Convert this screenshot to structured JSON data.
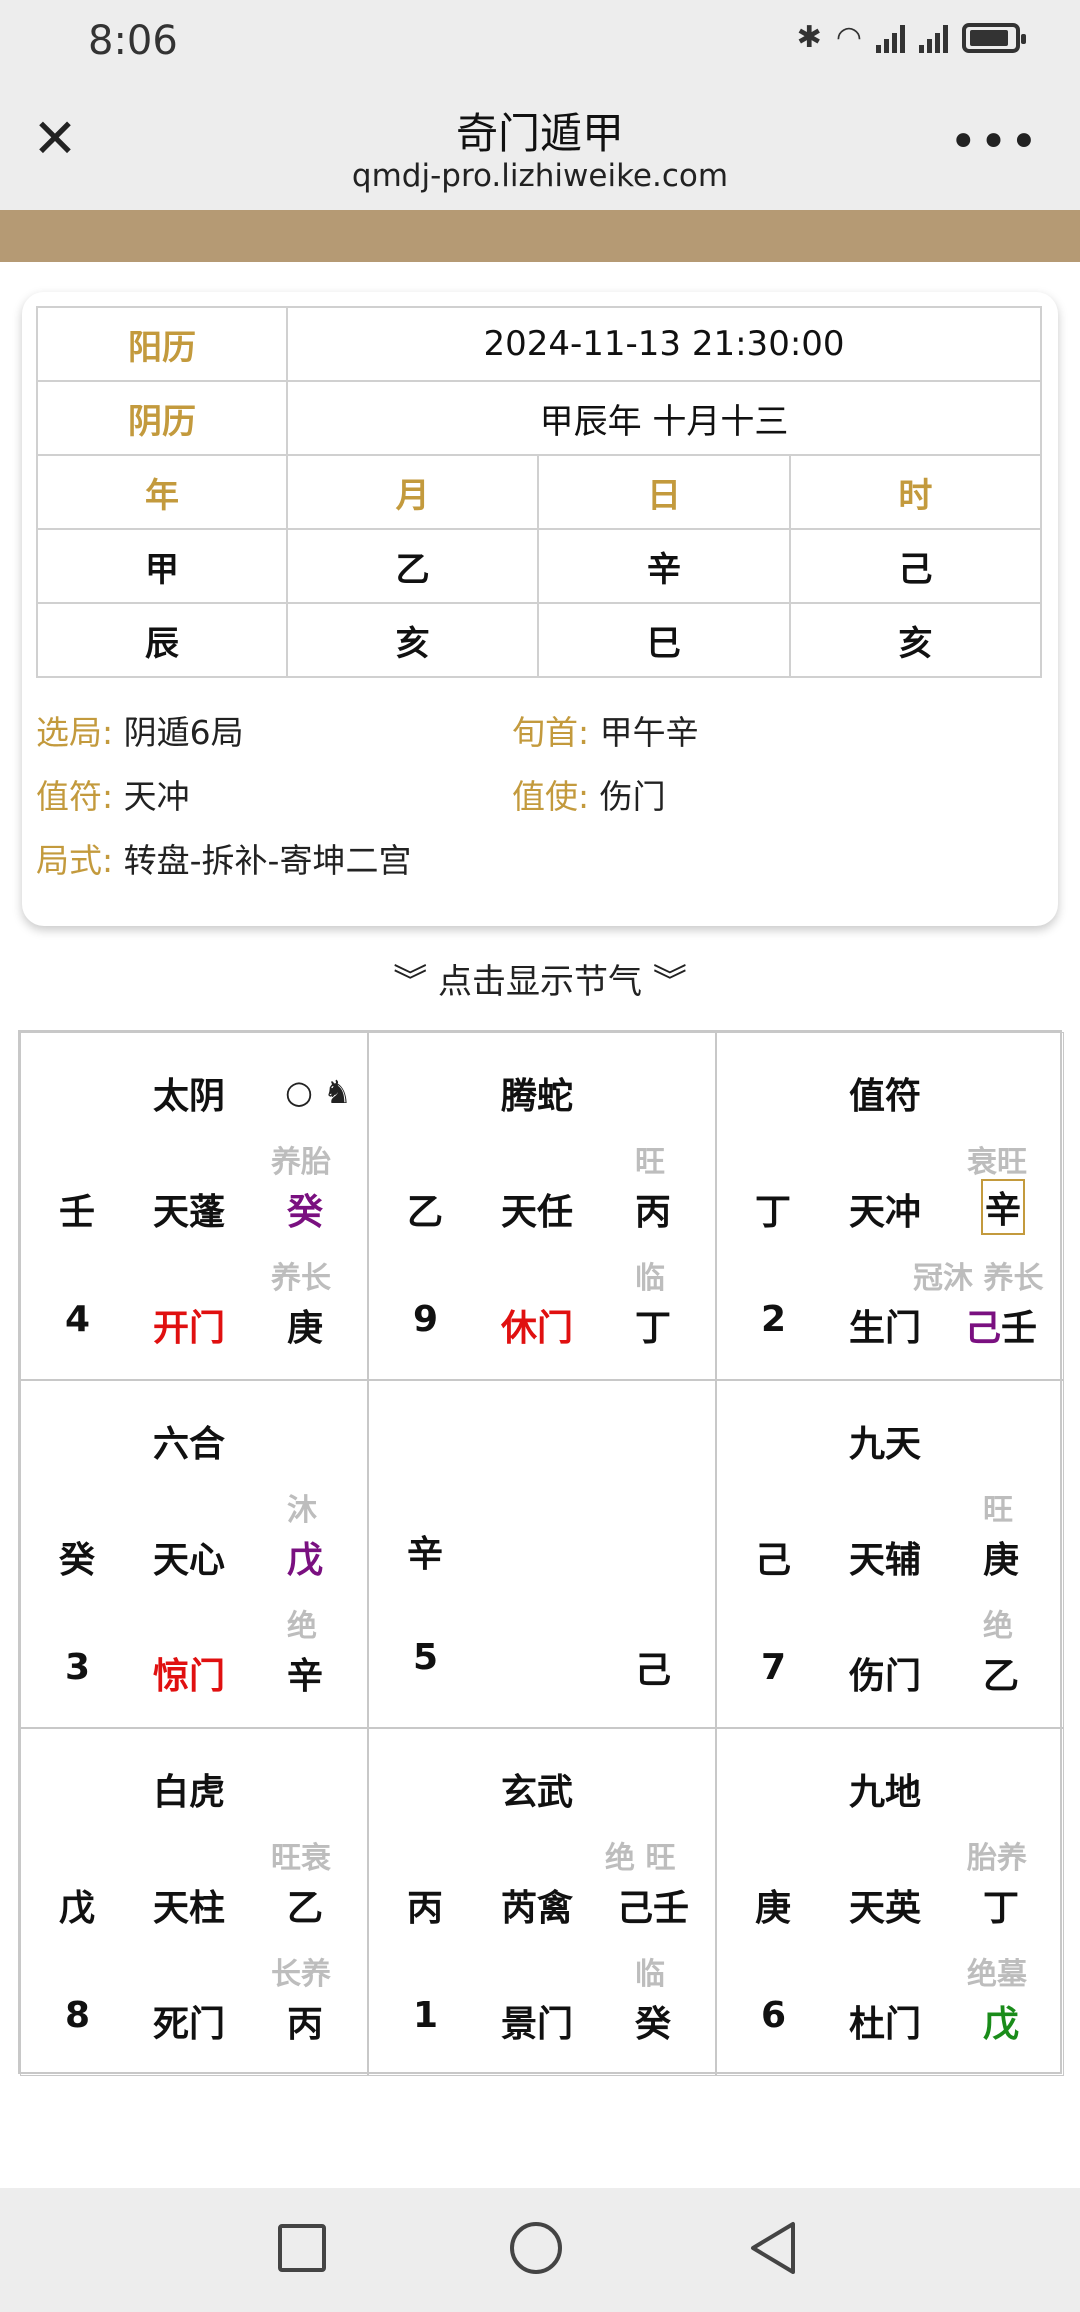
{
  "status": {
    "time": "8:06"
  },
  "nav": {
    "title": "奇门遁甲",
    "url": "qmdj-pro.lizhiweike.com"
  },
  "info": {
    "solar_label": "阳历",
    "solar_value": "2024-11-13 21:30:00",
    "lunar_label": "阴历",
    "lunar_value": "甲辰年 十月十三",
    "pillar_headers": [
      "年",
      "月",
      "日",
      "时"
    ],
    "stems": [
      "甲",
      "乙",
      "辛",
      "己"
    ],
    "branches": [
      "辰",
      "亥",
      "巳",
      "亥"
    ],
    "xuanju_label": "选局:",
    "xuanju_value": "阴遁6局",
    "xunshou_label": "旬首:",
    "xunshou_value": "甲午辛",
    "zhifu_label": "值符:",
    "zhifu_value": "天冲",
    "zhishi_label": "值使:",
    "zhishi_value": "伤门",
    "jushi_label": "局式:",
    "jushi_value": "转盘-拆补-寄坤二宫"
  },
  "toggle_label": "点击显示节气",
  "grid": {
    "c0": {
      "god": "太阴",
      "left_stem": "壬",
      "star": "天蓬",
      "right_stem": "癸",
      "top_state": "养胎",
      "num": "4",
      "door": "开门",
      "bottom_stem": "庚",
      "bottom_state": "养长"
    },
    "c1": {
      "god": "腾蛇",
      "left_stem": "乙",
      "star": "天任",
      "right_stem": "丙",
      "top_state": "旺",
      "num": "9",
      "door": "休门",
      "bottom_stem": "丁",
      "bottom_state": "临"
    },
    "c2": {
      "god": "值符",
      "left_stem": "丁",
      "star": "天冲",
      "right_stem": "辛",
      "top_state": "衰旺",
      "num": "2",
      "door": "生门",
      "bottom_stem_a": "己",
      "bottom_stem_b": "壬",
      "bottom_state": "冠沐 养长"
    },
    "c3": {
      "god": "六合",
      "left_stem": "癸",
      "star": "天心",
      "right_stem": "戊",
      "top_state": "沐",
      "num": "3",
      "door": "惊门",
      "bottom_stem": "辛",
      "bottom_state": "绝"
    },
    "c4": {
      "left_stem": "辛",
      "num": "5",
      "bottom_stem": "己"
    },
    "c5": {
      "god": "九天",
      "left_stem": "己",
      "star": "天辅",
      "right_stem": "庚",
      "top_state": "旺",
      "num": "7",
      "door": "伤门",
      "bottom_stem": "乙",
      "bottom_state": "绝"
    },
    "c6": {
      "god": "白虎",
      "left_stem": "戊",
      "star": "天柱",
      "right_stem": "乙",
      "top_state": "旺衰",
      "num": "8",
      "door": "死门",
      "bottom_stem": "丙",
      "bottom_state": "长养"
    },
    "c7": {
      "god": "玄武",
      "left_stem": "丙",
      "star": "芮禽",
      "right_stem": "己壬",
      "top_state": "绝 旺",
      "num": "1",
      "door": "景门",
      "bottom_stem": "癸",
      "bottom_state": "临"
    },
    "c8": {
      "god": "九地",
      "left_stem": "庚",
      "star": "天英",
      "right_stem": "丁",
      "top_state": "胎养",
      "num": "6",
      "door": "杜门",
      "bottom_stem": "戊",
      "bottom_state": "绝墓"
    }
  },
  "colors": {
    "gold": "#c39a3d",
    "brown_band": "#b59a74",
    "red": "#e01010",
    "purple": "#7a1080",
    "green": "#1a8c1a"
  }
}
